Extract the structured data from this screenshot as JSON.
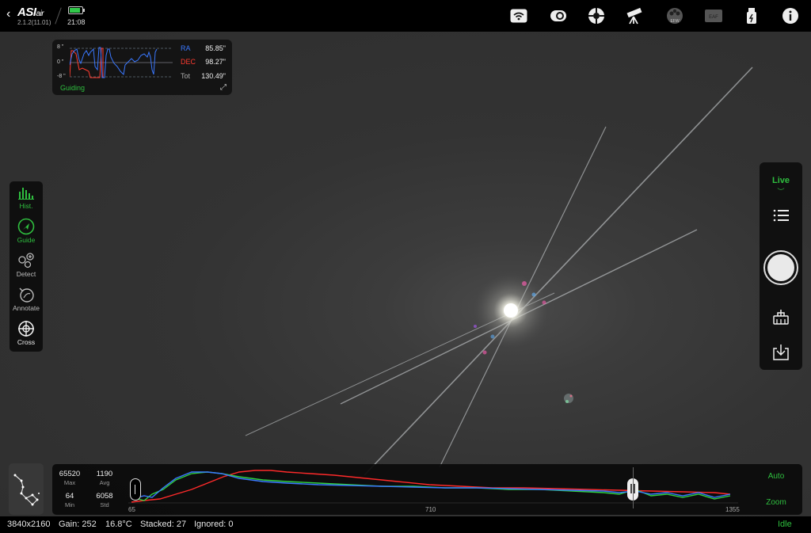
{
  "header": {
    "brand": "ASIair",
    "version": "2.1.2(11.01)",
    "clock": "21:08",
    "battery_level": 0.85,
    "icons": [
      "wifi-icon",
      "camera-icon",
      "mount-icon",
      "telescope-icon",
      "efw-icon",
      "eaf-icon",
      "usb-power-icon",
      "info-icon"
    ],
    "efw_label": "EFW",
    "eaf_label": "EAF"
  },
  "guiding": {
    "axis_top": "8 \"",
    "axis_mid": "0 \"",
    "axis_bottom": "-8 \"",
    "ra_label": "RA",
    "ra_value": "85.85\"",
    "dec_label": "DEC",
    "dec_value": "98.27\"",
    "tot_label": "Tot",
    "tot_value": "130.49\"",
    "status": "Guiding",
    "colors": {
      "ra": "#3a78ff",
      "dec": "#ff3b30",
      "active": "#2fbf3f"
    }
  },
  "left_toolbar": {
    "items": [
      {
        "label": "Hist.",
        "icon": "histogram-icon",
        "active": true
      },
      {
        "label": "Guide",
        "icon": "guide-icon",
        "active": true
      },
      {
        "label": "Detect",
        "icon": "detect-icon",
        "active": false
      },
      {
        "label": "Annotate",
        "icon": "annotate-icon",
        "active": false
      },
      {
        "label": "Cross",
        "icon": "crosshair-icon",
        "active": false
      }
    ]
  },
  "right_toolbar": {
    "mode": "Live",
    "mode_chevron": "︶",
    "icons": [
      "list-icon",
      "shutter-button",
      "tools-icon",
      "save-icon"
    ]
  },
  "histogram": {
    "max_value": "65520",
    "max_label": "Max",
    "avg_value": "1190",
    "avg_label": "Avg",
    "min_value": "64",
    "min_label": "Min",
    "std_value": "6058",
    "std_label": "Std",
    "tick_left": "65",
    "tick_mid": "710",
    "tick_right": "1355",
    "auto_label": "Auto",
    "zoom_label": "Zoom"
  },
  "status": {
    "resolution": "3840x2160",
    "gain": "Gain: 252",
    "temperature": "16.8°C",
    "stacked": "Stacked: 27",
    "ignored": "Ignored: 0",
    "state": "Idle"
  }
}
